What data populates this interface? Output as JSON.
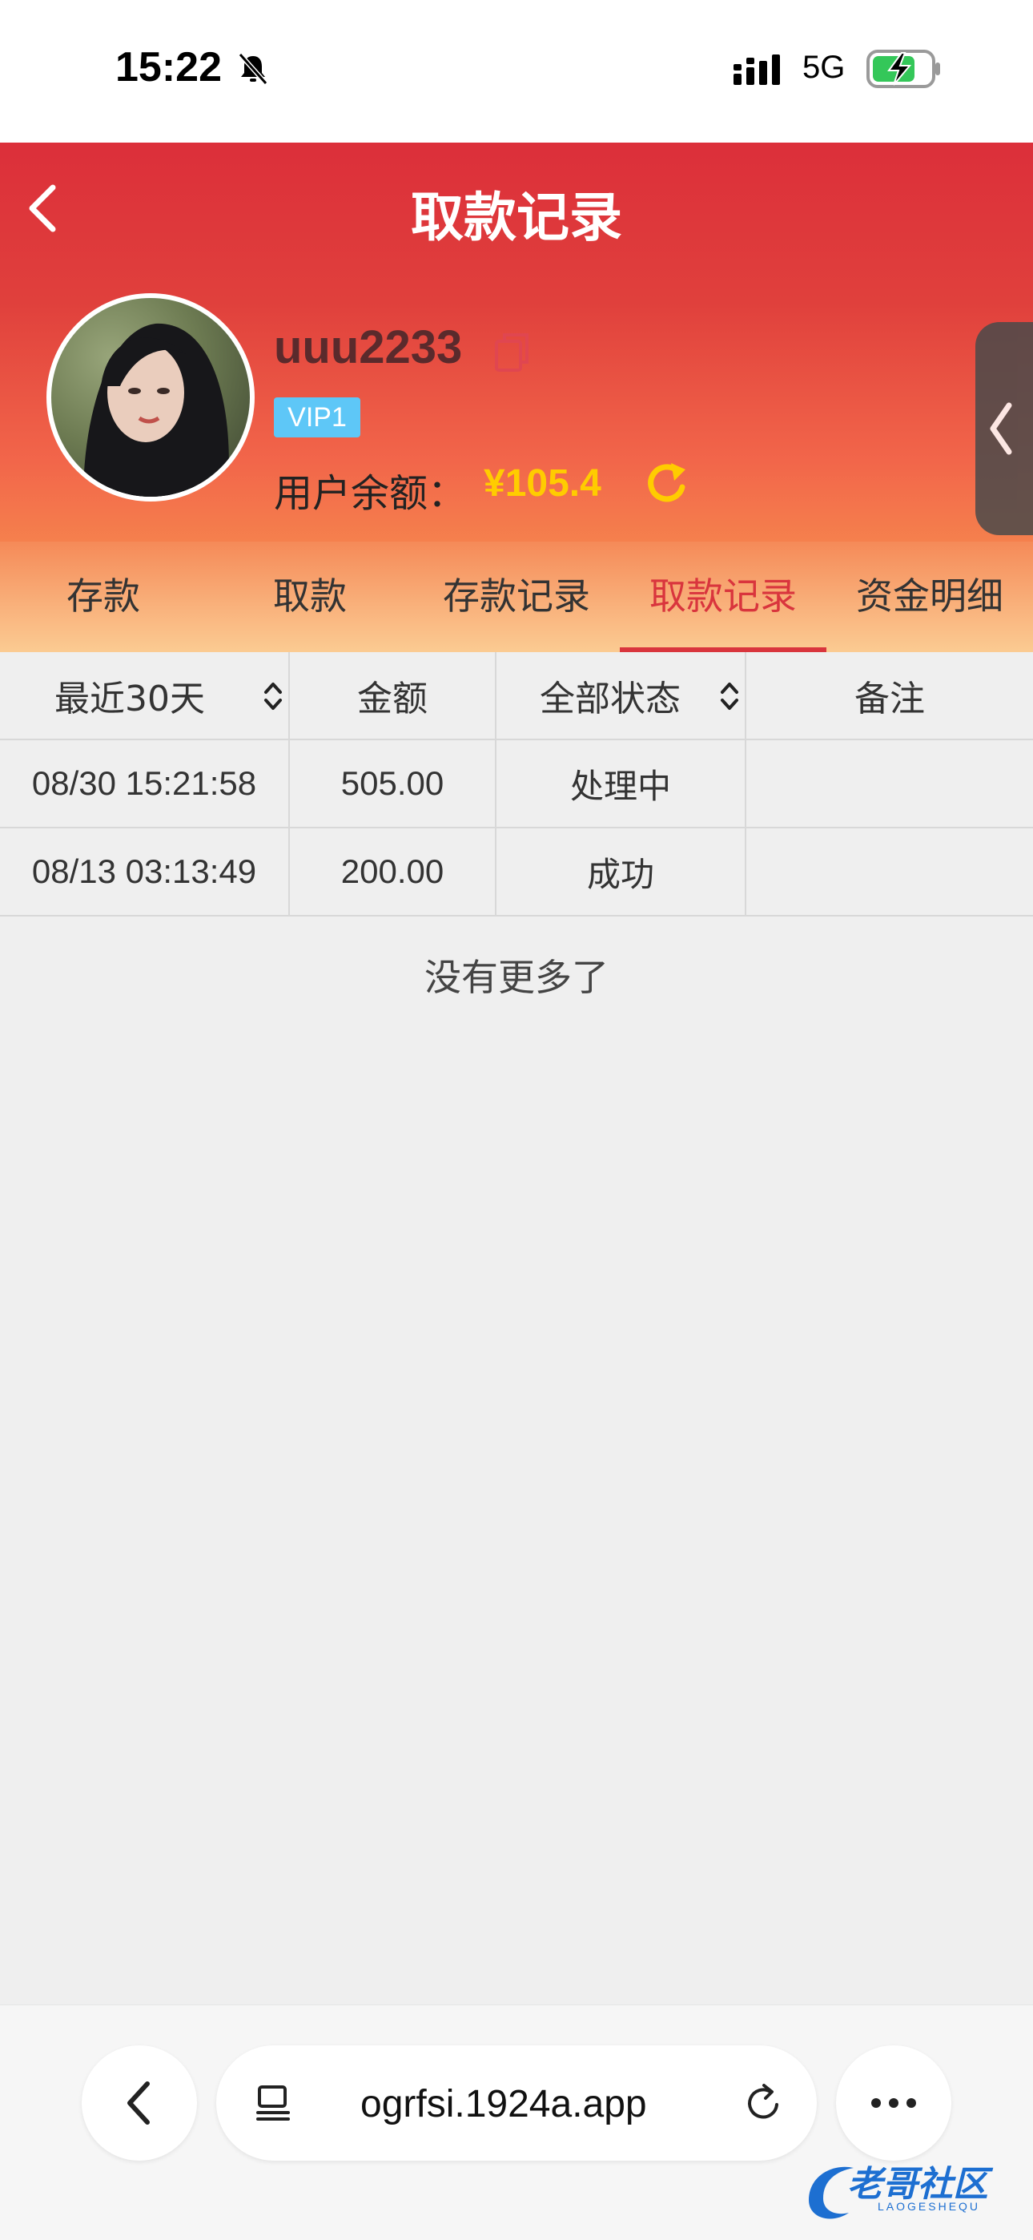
{
  "status_bar": {
    "time": "15:22",
    "network": "5G"
  },
  "header": {
    "title": "取款记录",
    "username": "uuu2233",
    "vip": "VIP1",
    "balance_label": "用户余额：",
    "balance_value": "¥105.4"
  },
  "tabs": [
    {
      "label": "存款",
      "active": false
    },
    {
      "label": "取款",
      "active": false
    },
    {
      "label": "存款记录",
      "active": false
    },
    {
      "label": "取款记录",
      "active": true
    },
    {
      "label": "资金明细",
      "active": false
    }
  ],
  "table": {
    "headers": {
      "date": "最近30天",
      "amount": "金额",
      "status": "全部状态",
      "note": "备注"
    },
    "rows": [
      {
        "date": "08/30 15:21:58",
        "amount": "505.00",
        "status": "处理中",
        "note": ""
      },
      {
        "date": "08/13 03:13:49",
        "amount": "200.00",
        "status": "成功",
        "note": ""
      }
    ],
    "end_text": "没有更多了"
  },
  "browser": {
    "url": "ogrfsi.1924a.app"
  },
  "watermark": {
    "text": "老哥社区",
    "sub": "LAOGESHEQU"
  },
  "colors": {
    "accent": "#d9353d",
    "balance": "#ffcc00",
    "vip": "#5ec7f7"
  }
}
